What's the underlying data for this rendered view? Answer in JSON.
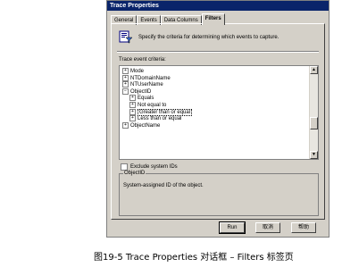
{
  "window": {
    "title": "Trace Properties"
  },
  "tabs": [
    {
      "label": "General",
      "active": false
    },
    {
      "label": "Events",
      "active": false
    },
    {
      "label": "Data Columns",
      "active": false
    },
    {
      "label": "Filters",
      "active": true
    }
  ],
  "header": {
    "icon": "filter-properties-icon",
    "text": "Specify the criteria for determining which events to capture."
  },
  "criteria": {
    "label": "Trace event criteria:",
    "items": [
      {
        "label": "Mode",
        "level": 0,
        "expander": "+"
      },
      {
        "label": "NTDomainName",
        "level": 0,
        "expander": "+"
      },
      {
        "label": "NTUserName",
        "level": 0,
        "expander": "+"
      },
      {
        "label": "ObjectID",
        "level": 0,
        "expander": "−"
      },
      {
        "label": "Equals",
        "level": 1,
        "expander": "+"
      },
      {
        "label": "Not equal to",
        "level": 1,
        "expander": "+"
      },
      {
        "label": "Greater than or equal",
        "level": 1,
        "expander": "+",
        "selected": true
      },
      {
        "label": "Less than or equal",
        "level": 1,
        "expander": "+"
      },
      {
        "label": "ObjectName",
        "level": 0,
        "expander": "+"
      }
    ]
  },
  "exclude": {
    "label": "Exclude system IDs",
    "checked": false
  },
  "description": {
    "title": "ObjectID",
    "text": "System-assigned ID of the object."
  },
  "buttons": {
    "run": "Run",
    "cancel": "取消",
    "help": "帮助"
  },
  "caption": "图19-5  Trace Properties 对话框  – Filters 标签页"
}
